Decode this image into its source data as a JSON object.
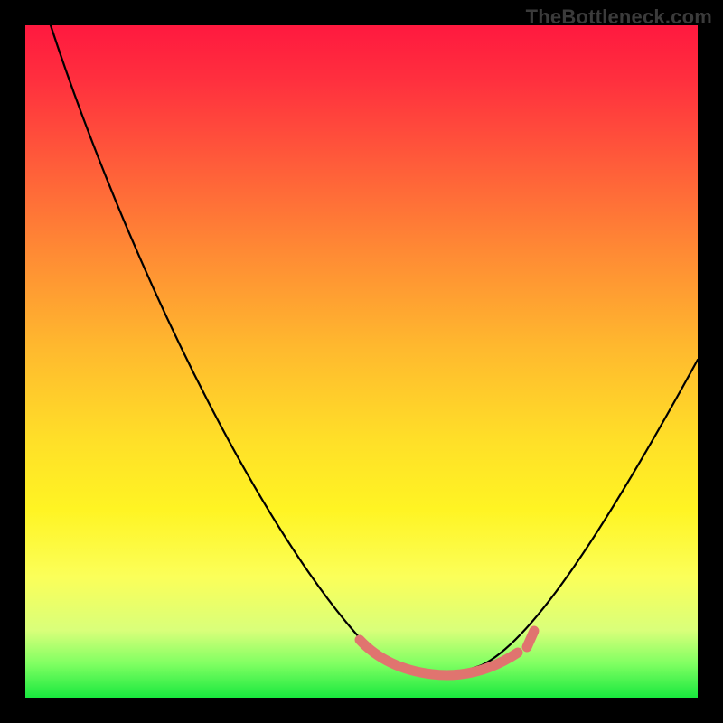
{
  "watermark": "TheBottleneck.com",
  "colors": {
    "gradient_top": "#ff193f",
    "gradient_mid": "#ffe028",
    "gradient_bottom": "#18e83e",
    "curve": "#000000",
    "band": "#e0746f",
    "frame": "#000000"
  },
  "chart_data": {
    "type": "line",
    "title": "",
    "xlabel": "",
    "ylabel": "",
    "xlim": [
      0,
      100
    ],
    "ylim": [
      0,
      100
    ],
    "grid": false,
    "legend": false,
    "series": [
      {
        "name": "bottleneck-curve",
        "x": [
          4,
          10,
          20,
          30,
          40,
          50,
          53,
          60,
          68,
          72,
          80,
          90,
          100
        ],
        "y": [
          100,
          85,
          65,
          48,
          30,
          12,
          5,
          3,
          5,
          8,
          20,
          38,
          50
        ]
      }
    ],
    "annotations": [
      {
        "name": "optimal-band",
        "x_range": [
          50,
          73
        ],
        "y_approx": 4,
        "color": "#e0746f"
      }
    ],
    "background": "vertical-gradient red→green (heat scale)"
  }
}
